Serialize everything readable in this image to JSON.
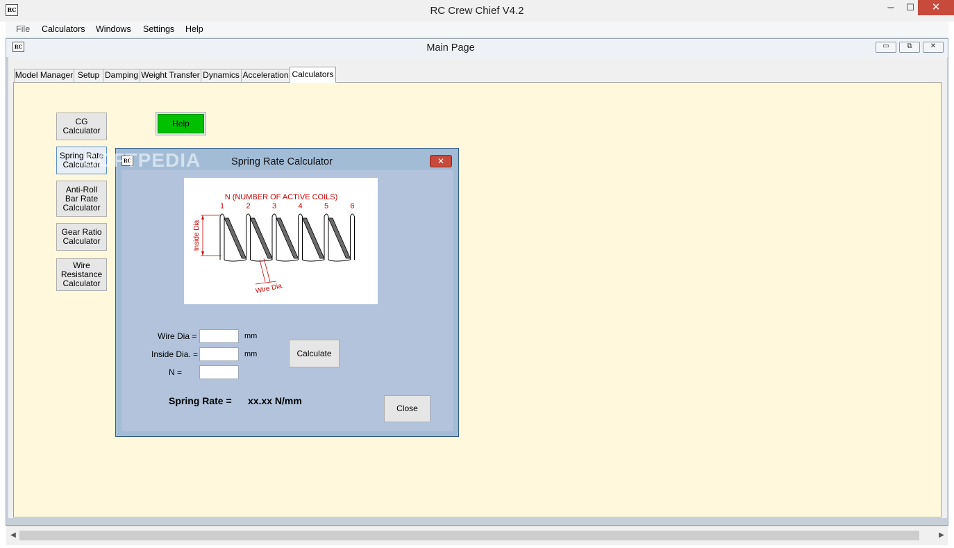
{
  "app": {
    "title": "RC Crew Chief V4.2",
    "icon_text": "RC"
  },
  "window_controls": {
    "minimize": "─",
    "maximize": "☐",
    "close": "✕"
  },
  "menu": [
    "File",
    "Calculators",
    "Windows",
    "Settings",
    "Help"
  ],
  "mdi": {
    "title": "Main Page",
    "minimize": "▭",
    "restore": "⧉",
    "close": "✕"
  },
  "tabs": [
    "Model Manager",
    "Setup",
    "Damping",
    "Weight Transfer",
    "Dynamics",
    "Acceleration",
    "Calculators"
  ],
  "active_tab": "Calculators",
  "side_buttons": [
    {
      "label": "CG Calculator"
    },
    {
      "label": "Spring Rate Calculator"
    },
    {
      "label": "Anti-Roll Bar Rate Calculator"
    },
    {
      "label": "Gear Ratio Calculator"
    },
    {
      "label": "Wire Resistance Calculator"
    }
  ],
  "help_button": "Help",
  "watermark": "SOFTPEDIA",
  "dialog": {
    "title": "Spring Rate Calculator",
    "icon_text": "RC",
    "close": "✕",
    "diagram": {
      "heading": "N (NUMBER OF ACTIVE COILS)",
      "coil_numbers": [
        "1",
        "2",
        "3",
        "4",
        "5",
        "6"
      ],
      "inside_dia_label": "Inside Dia",
      "wire_dia_label": "Wire Dia."
    },
    "fields": [
      {
        "label": "Wire Dia =",
        "value": "",
        "unit": "mm"
      },
      {
        "label": "Inside Dia. =",
        "value": "",
        "unit": "mm"
      },
      {
        "label": "N =",
        "value": "",
        "unit": ""
      }
    ],
    "calculate_button": "Calculate",
    "close_button": "Close",
    "result_label": "Spring Rate =",
    "result_value": "xx.xx N/mm"
  },
  "colors": {
    "panel_bg": "#fff8dd",
    "dialog_bg": "#b3c3dc",
    "help_green": "#00c000",
    "diagram_red": "#cc0000"
  }
}
